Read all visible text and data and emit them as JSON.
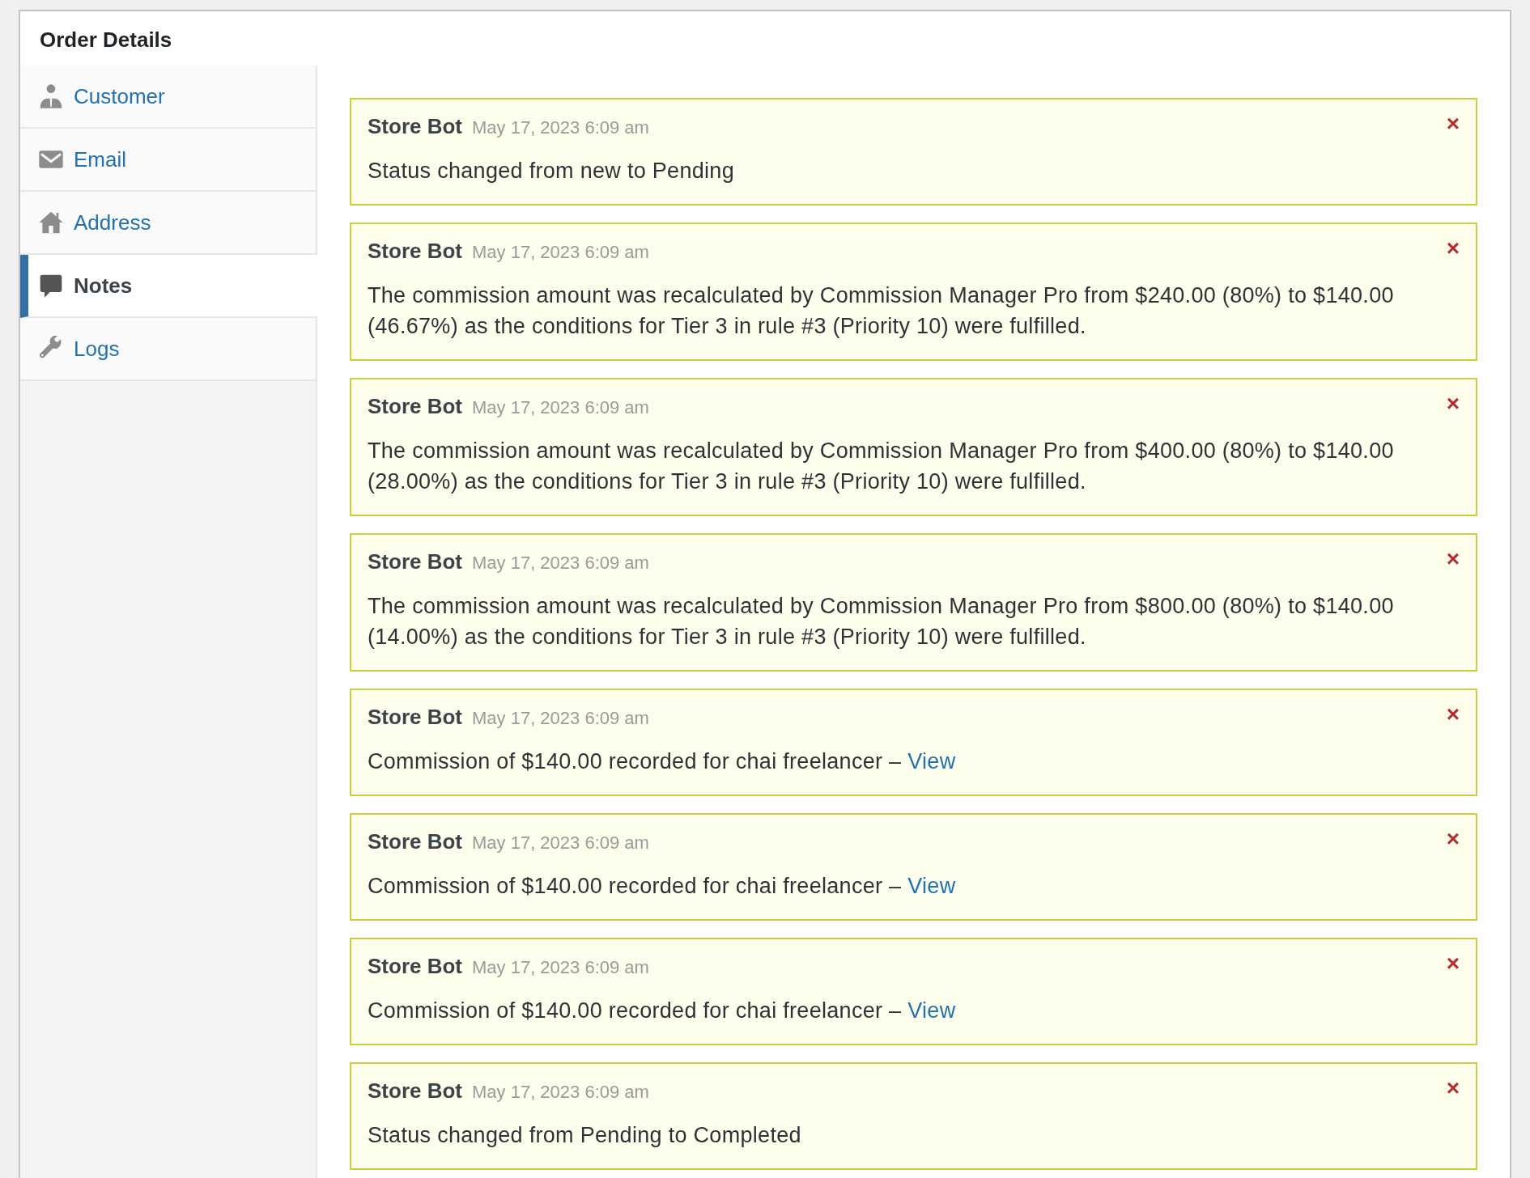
{
  "panel": {
    "title": "Order Details"
  },
  "tabs": [
    {
      "label": "Customer",
      "kind": "person",
      "selected": false
    },
    {
      "label": "Email",
      "kind": "envelope",
      "selected": false
    },
    {
      "label": "Address",
      "kind": "house",
      "selected": false
    },
    {
      "label": "Notes",
      "kind": "bubble",
      "selected": true
    },
    {
      "label": "Logs",
      "kind": "wrench",
      "selected": false
    }
  ],
  "notes": [
    {
      "author": "Store Bot",
      "date": "May 17, 2023 6:09 am",
      "text": "Status changed from new to Pending",
      "delete": "×"
    },
    {
      "author": "Store Bot",
      "date": "May 17, 2023 6:09 am",
      "text": "The commission amount was recalculated by Commission Manager Pro from $240.00 (80%) to $140.00 (46.67%) as the conditions for Tier 3 in rule #3 (Priority 10) were fulfilled.",
      "delete": "×"
    },
    {
      "author": "Store Bot",
      "date": "May 17, 2023 6:09 am",
      "text": "The commission amount was recalculated by Commission Manager Pro from $400.00 (80%) to $140.00 (28.00%) as the conditions for Tier 3 in rule #3 (Priority 10) were fulfilled.",
      "delete": "×"
    },
    {
      "author": "Store Bot",
      "date": "May 17, 2023 6:09 am",
      "text": "The commission amount was recalculated by Commission Manager Pro from $800.00 (80%) to $140.00 (14.00%) as the conditions for Tier 3 in rule #3 (Priority 10) were fulfilled.",
      "delete": "×"
    },
    {
      "author": "Store Bot",
      "date": "May 17, 2023 6:09 am",
      "text": "Commission of $140.00 recorded for chai freelancer – ",
      "link": "View",
      "delete": "×"
    },
    {
      "author": "Store Bot",
      "date": "May 17, 2023 6:09 am",
      "text": "Commission of $140.00 recorded for chai freelancer – ",
      "link": "View",
      "delete": "×"
    },
    {
      "author": "Store Bot",
      "date": "May 17, 2023 6:09 am",
      "text": "Commission of $140.00 recorded for chai freelancer – ",
      "link": "View",
      "delete": "×"
    },
    {
      "author": "Store Bot",
      "date": "May 17, 2023 6:09 am",
      "text": "Status changed from Pending to Completed",
      "delete": "×"
    }
  ]
}
